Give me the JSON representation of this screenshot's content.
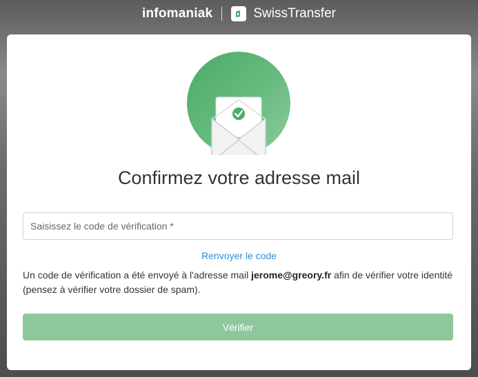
{
  "header": {
    "brand_primary": "infomaniak",
    "brand_secondary": "SwissTransfer"
  },
  "card": {
    "title": "Confirmez votre adresse mail",
    "code_input": {
      "placeholder": "Saisissez le code de vérification *",
      "value": ""
    },
    "resend_label": "Renvoyer le code",
    "info": {
      "before": "Un code de vérification a été envoyé à l'adresse mail ",
      "email": "jerome@greory.fr",
      "after": " afin de vérifier votre identité (pensez à vérifier votre dossier de spam)."
    },
    "verify_label": "Vérifier"
  },
  "colors": {
    "accent_green": "#4cab6a",
    "button_disabled_green": "#8fc79c",
    "link_blue": "#2a8fd6"
  },
  "icons": {
    "hero": "envelope-check-icon",
    "brand_logo": "swisstransfer-logo-icon"
  }
}
